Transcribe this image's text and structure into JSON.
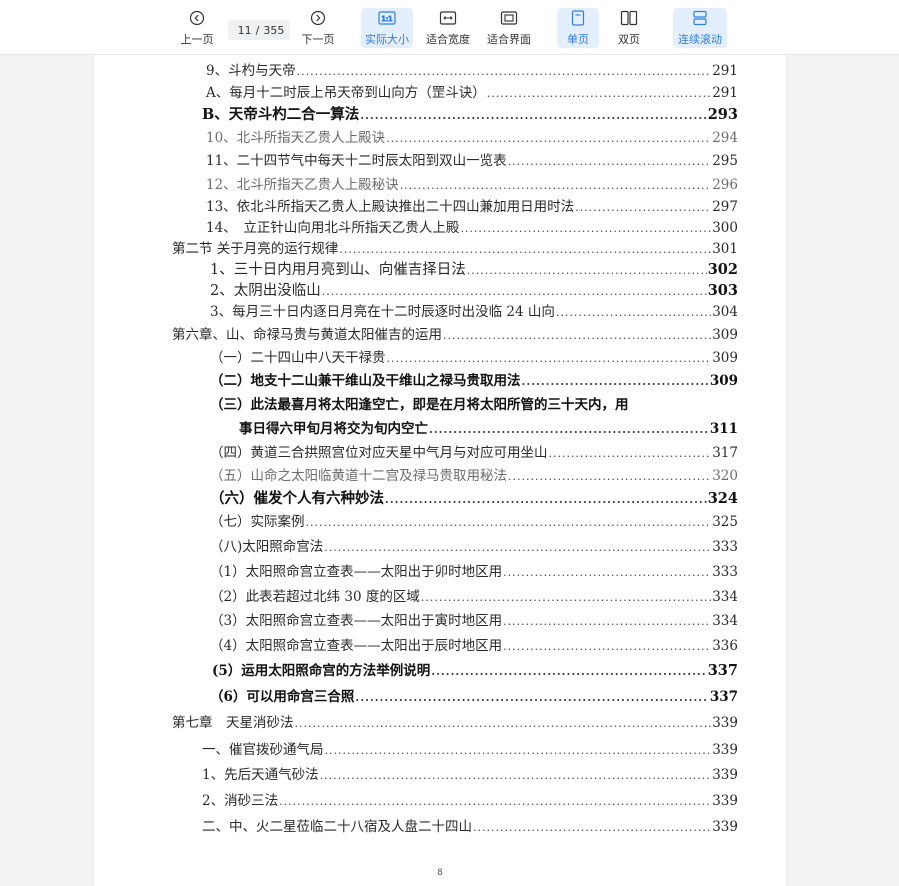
{
  "toolbar": {
    "prev_label": "上一页",
    "next_label": "下一页",
    "current_page": "11",
    "page_separator": "/",
    "total_pages": "355",
    "actual_size_label": "实际大小",
    "fit_width_label": "适合宽度",
    "fit_page_label": "适合界面",
    "single_page_label": "单页",
    "double_page_label": "双页",
    "continuous_scroll_label": "连续滚动",
    "accent_color": "#2f7de1"
  },
  "document": {
    "footer_page_number": "8",
    "toc": [
      {
        "text": "9、斗杓与天帝",
        "page": "291"
      },
      {
        "text": "A、每月十二时辰上吊天帝到山向方（罡斗诀）",
        "page": "291"
      },
      {
        "text": "B、天帝斗杓二合一算法",
        "page": "293"
      },
      {
        "text": "10、北斗所指天乙贵人上殿诀",
        "page": "294"
      },
      {
        "text": "11、二十四节气中每天十二时辰太阳到双山一览表",
        "page": "295"
      },
      {
        "text": "12、北斗所指天乙贵人上殿秘诀",
        "page": "296"
      },
      {
        "text": "13、依北斗所指天乙贵人上殿诀推出二十四山兼加用日用时法",
        "page": "297"
      },
      {
        "text": "14、　立正针山向用北斗所指天乙贵人上殿",
        "page": "300"
      },
      {
        "text": "第二节 关于月亮的运行规律",
        "page": "301"
      },
      {
        "text": "1、三十日内用月亮到山、向催吉择日法",
        "page": "302"
      },
      {
        "text": "2、太阴出没临山",
        "page": "303"
      },
      {
        "text": "3、每月三十日内逐日月亮在十二时辰逐时出没临 24 山向",
        "page": "304"
      },
      {
        "text": "第六章、山、命禄马贵与黄道太阳催吉的运用",
        "page": "309"
      },
      {
        "text": "（一）二十四山中八天干禄贵",
        "page": "309"
      },
      {
        "text": "（二）地支十二山兼干维山及干维山之禄马贵取用法",
        "page": "309"
      },
      {
        "text": "（三）此法最喜月将太阳逢空亡，即是在月将太阳所管的三十天内，用",
        "page": ""
      },
      {
        "text": "事日得六甲旬月将交为旬内空亡",
        "page": "311"
      },
      {
        "text": "（四）黄道三合拱照宫位对应天星中气月与对应可用坐山",
        "page": "317"
      },
      {
        "text": "（五）山命之太阳临黄道十二宫及禄马贵取用秘法",
        "page": "320"
      },
      {
        "text": "（六）催发个人有六种妙法",
        "page": "324"
      },
      {
        "text": "（七）实际案例",
        "page": "325"
      },
      {
        "text": "（八)太阳照命宫法",
        "page": "333"
      },
      {
        "text": "（1）太阳照命宫立查表——太阳出于卯时地区用",
        "page": "333"
      },
      {
        "text": "（2）此表若超过北纬 30 度的区域",
        "page": "334"
      },
      {
        "text": "（3）太阳照命宫立查表——太阳出于寅时地区用",
        "page": "334"
      },
      {
        "text": "（4）太阳照命宫立查表——太阳出于辰时地区用",
        "page": "336"
      },
      {
        "text": "(5）运用太阳照命宫的方法举例说明",
        "page": "337"
      },
      {
        "text": "（6）可以用命宫三合照",
        "page": "337"
      },
      {
        "text": "第七章　天星消砂法",
        "page": "339"
      },
      {
        "text": "一、催官拨砂通气局",
        "page": "339"
      },
      {
        "text": "1、先后天通气砂法",
        "page": "339"
      },
      {
        "text": "2、消砂三法",
        "page": "339"
      },
      {
        "text": "二、中、火二星莅临二十八宿及人盘二十四山",
        "page": "339"
      }
    ]
  }
}
